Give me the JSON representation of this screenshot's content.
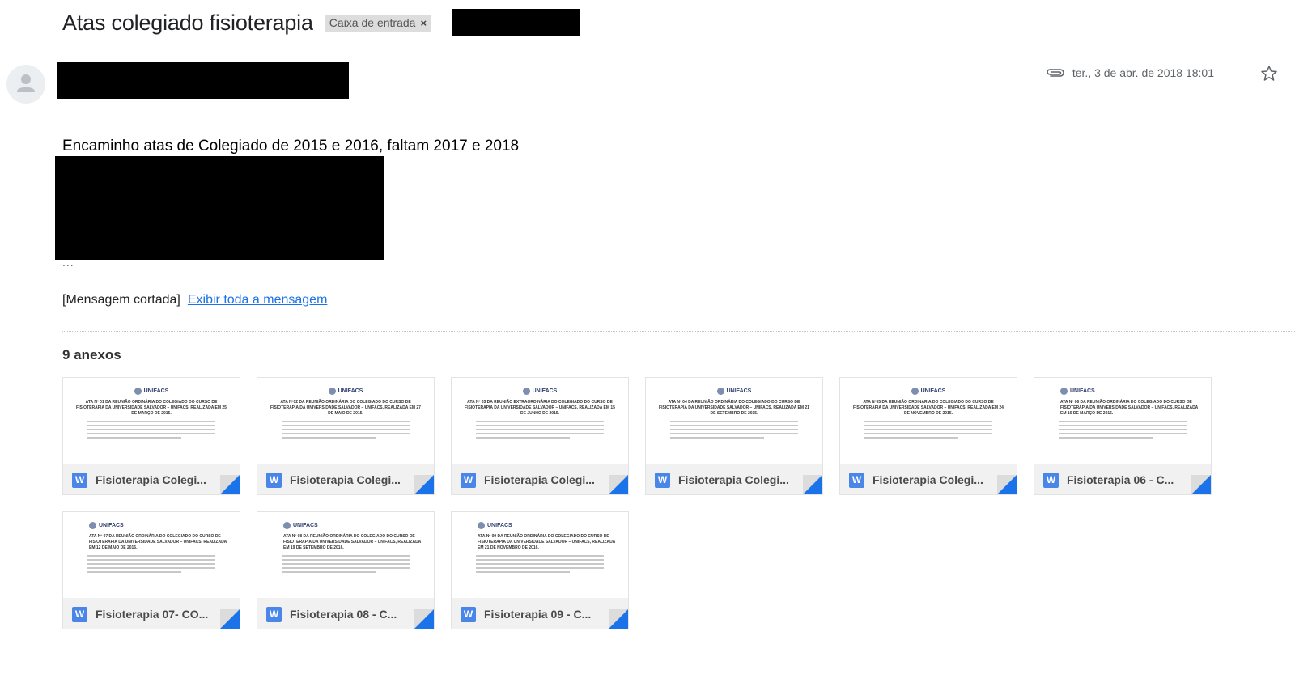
{
  "email": {
    "subject": "Atas colegiado fisioterapia",
    "label_chip": "Caixa de entrada",
    "label_remove": "×",
    "date": "ter., 3 de abr. de 2018 18:01",
    "body_text": "Encaminho atas de Colegiado de 2015 e 2016, faltam 2017 e 2018",
    "ellipsis": "...",
    "clipped_text": "[Mensagem cortada]",
    "view_full_link": "Exibir toda a mensagem",
    "attachment_count_label": "9 anexos"
  },
  "attachments": [
    {
      "name": "Fisioterapia Colegi...",
      "logo": "UNIFACS",
      "doc_title": "ATA Nº 01 DA REUNIÃO ORDINÁRIA DO COLEGIADO DO CURSO DE FISIOTERAPIA DA UNIVERSIDADE SALVADOR – UNIFACS, REALIZADA EM 25 DE MARÇO DE 2015."
    },
    {
      "name": "Fisioterapia Colegi...",
      "logo": "UNIFACS",
      "doc_title": "ATA Nº02 DA REUNIÃO ORDINÁRIA DO COLEGIADO DO CURSO DE FISIOTERAPIA DA UNIVERSIDADE SALVADOR – UNIFACS, REALIZADA EM 27 DE MAIO DE 2015."
    },
    {
      "name": "Fisioterapia Colegi...",
      "logo": "UNIFACS",
      "doc_title": "ATA Nº 03 DA REUNIÃO EXTRAORDINÁRIA DO COLEGIADO DO CURSO DE FISIOTERAPIA DA UNIVERSIDADE SALVADOR – UNIFACS, REALIZADA EM 15 DE JUNHO DE 2015."
    },
    {
      "name": "Fisioterapia Colegi...",
      "logo": "UNIFACS",
      "doc_title": "ATA Nº 04 DA REUNIÃO ORDINÁRIA DO COLEGIADO DO CURSO DE FISIOTERAPIA DA UNIVERSIDADE SALVADOR – UNIFACS, REALIZADA EM 21 DE SETEMBRO DE 2015."
    },
    {
      "name": "Fisioterapia Colegi...",
      "logo": "UNIFACS",
      "doc_title": "ATA Nº05 DA REUNIÃO ORDINÁRIA DO COLEGIADO DO CURSO DE FISIOTERAPIA DA UNIVERSIDADE SALVADOR – UNIFACS, REALIZADA EM 24 DE NOVEMBRO DE 2015."
    },
    {
      "name": "Fisioterapia 06 - C...",
      "logo": "UNIFACS",
      "doc_title": "ATA Nº 06 DA REUNIÃO ORDINÁRIA DO COLEGIADO DO CURSO DE FISIOTERAPIA DA UNIVERSIDADE SALVADOR – UNIFACS, REALIZADA EM 16 DE MARÇO DE 2016."
    },
    {
      "name": "Fisioterapia 07- CO...",
      "logo": "UNIFACS",
      "doc_title": "ATA Nº 07 DA REUNIÃO ORDINÁRIA DO COLEGIADO DO CURSO DE FISIOTERAPIA DA UNIVERSIDADE SALVADOR – UNIFACS, REALIZADA EM 12 DE MAIO DE 2016."
    },
    {
      "name": "Fisioterapia 08 - C...",
      "logo": "UNIFACS",
      "doc_title": "ATA Nº 08 DA REUNIÃO ORDINÁRIA DO COLEGIADO DO CURSO DE FISIOTERAPIA DA UNIVERSIDADE SALVADOR – UNIFACS, REALIZADA EM 19 DE SETEMBRO DE 2016."
    },
    {
      "name": "Fisioterapia 09 - C...",
      "logo": "UNIFACS",
      "doc_title": "ATA Nº 09 DA REUNIÃO ORDINÁRIA DO COLEGIADO DO CURSO DE FISIOTERAPIA DA UNIVERSIDADE SALVADOR – UNIFACS, REALIZADA EM 21 DE NOVEMBRO DE 2016."
    }
  ],
  "icons": {
    "avatar": "person-icon",
    "attachment": "paperclip-icon",
    "star": "star-icon",
    "file_type": "word-doc-icon"
  },
  "colors": {
    "link": "#1a73e8",
    "word_icon": "#4a86e8",
    "label_chip_bg": "#dddddd"
  }
}
